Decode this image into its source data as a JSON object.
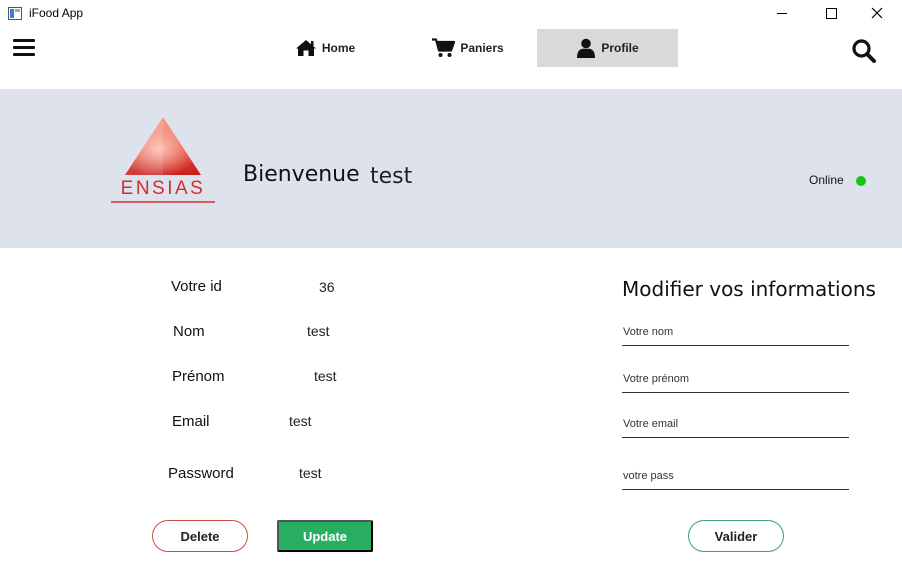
{
  "window": {
    "title": "iFood App"
  },
  "nav": {
    "tabs": [
      {
        "label": "Home",
        "icon": "home-icon"
      },
      {
        "label": "Paniers",
        "icon": "cart-icon"
      },
      {
        "label": "Profile",
        "icon": "user-icon",
        "active": true
      }
    ],
    "menu_icon": "menu-icon",
    "search_icon": "search-icon"
  },
  "banner": {
    "logo_text": "ENSIAS",
    "welcome": "Bienvenue",
    "username": "test",
    "status": "Online",
    "status_color": "#19c219"
  },
  "info": {
    "id_label": "Votre id",
    "id_value": "36",
    "nom_label": "Nom",
    "nom_value": "test",
    "prenom_label": "Prénom",
    "prenom_value": "test",
    "email_label": "Email",
    "email_value": "test",
    "password_label": "Password",
    "password_value": "test"
  },
  "actions": {
    "delete_label": "Delete",
    "update_label": "Update"
  },
  "form": {
    "title": "Modifier vos informations",
    "nom_placeholder": "Votre nom",
    "prenom_placeholder": "Votre prénom",
    "email_placeholder": "Votre email",
    "pass_placeholder": "votre pass",
    "submit_label": "Valider"
  },
  "colors": {
    "banner_bg": "#dee2ec",
    "update_green": "#27ae60",
    "delete_border": "#c5523a",
    "valider_border": "#3aa572"
  }
}
